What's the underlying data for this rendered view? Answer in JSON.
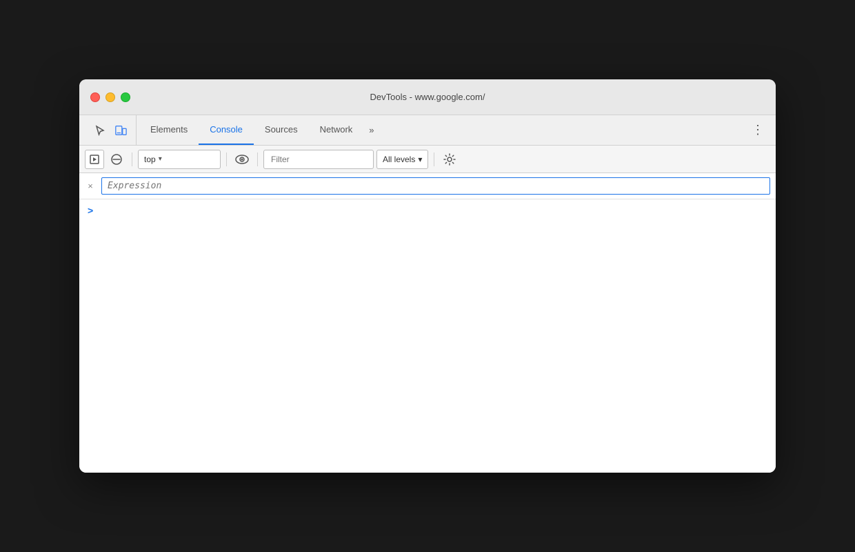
{
  "window": {
    "title": "DevTools - www.google.com/"
  },
  "traffic_lights": {
    "close_label": "close",
    "minimize_label": "minimize",
    "maximize_label": "maximize"
  },
  "tabs": {
    "items": [
      {
        "id": "elements",
        "label": "Elements",
        "active": false
      },
      {
        "id": "console",
        "label": "Console",
        "active": true
      },
      {
        "id": "sources",
        "label": "Sources",
        "active": false
      },
      {
        "id": "network",
        "label": "Network",
        "active": false
      }
    ],
    "more_label": "»",
    "menu_label": "⋮"
  },
  "toolbar": {
    "context_value": "top",
    "context_arrow": "▾",
    "filter_placeholder": "Filter",
    "levels_label": "All levels",
    "levels_arrow": "▾"
  },
  "live_expression": {
    "close_label": "×",
    "placeholder": "Expression"
  },
  "console": {
    "prompt_symbol": ">"
  }
}
